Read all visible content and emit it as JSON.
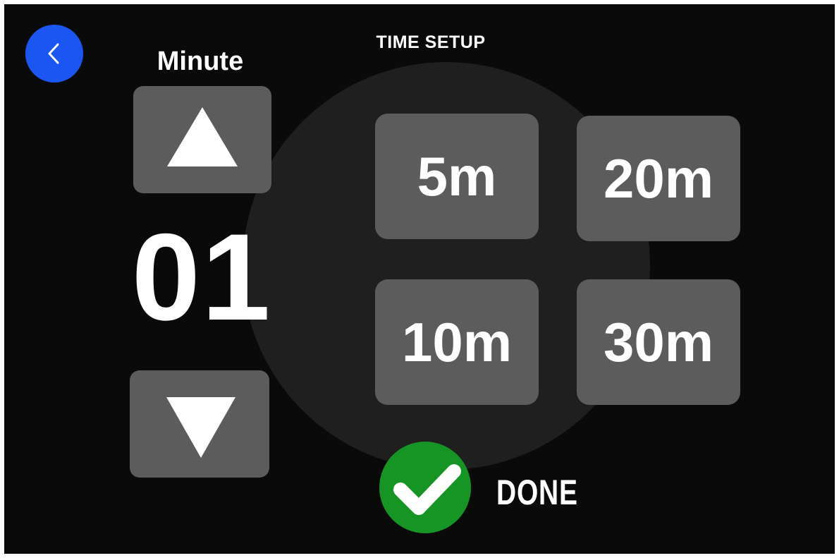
{
  "header": {
    "title": "TIME SETUP",
    "back_icon": "chevron-left-icon",
    "back_color": "#1b55f2"
  },
  "minute_picker": {
    "label": "Minute",
    "value": "01",
    "up_icon": "triangle-up-icon",
    "down_icon": "triangle-down-icon"
  },
  "presets": [
    {
      "label": "5m"
    },
    {
      "label": "20m"
    },
    {
      "label": "10m"
    },
    {
      "label": "30m"
    }
  ],
  "done": {
    "label": "DONE",
    "icon": "checkmark-icon",
    "color": "#169424"
  },
  "colors": {
    "background": "#0b0a0a",
    "button": "#5c5c5d",
    "text": "#ffffff"
  }
}
